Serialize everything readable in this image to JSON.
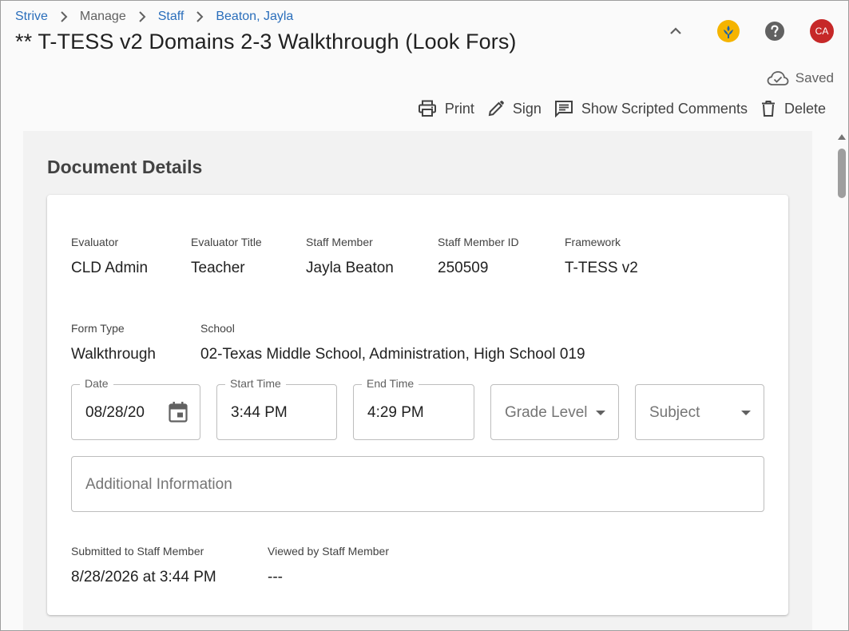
{
  "breadcrumb": {
    "items": [
      "Strive",
      "Manage",
      "Staff",
      "Beaton, Jayla"
    ]
  },
  "page_title": "** T-TESS v2 Domains 2-3 Walkthrough (Look Fors)",
  "header": {
    "avatar_initials": "CA",
    "avatar_color": "#c62828"
  },
  "status": {
    "saved_label": "Saved"
  },
  "toolbar": {
    "print_label": "Print",
    "sign_label": "Sign",
    "comments_label": "Show Scripted Comments",
    "delete_label": "Delete"
  },
  "document_details": {
    "title": "Document Details",
    "evaluator": {
      "label": "Evaluator",
      "value": "CLD Admin"
    },
    "evaluator_title": {
      "label": "Evaluator Title",
      "value": "Teacher"
    },
    "staff_member": {
      "label": "Staff Member",
      "value": "Jayla Beaton"
    },
    "staff_member_id": {
      "label": "Staff Member ID",
      "value": "250509"
    },
    "framework": {
      "label": "Framework",
      "value": "T-TESS v2"
    },
    "form_type": {
      "label": "Form Type",
      "value": "Walkthrough"
    },
    "school": {
      "label": "School",
      "value": "02-Texas Middle School, Administration, High School 019"
    },
    "date": {
      "label": "Date",
      "value": "08/28/20"
    },
    "start_time": {
      "label": "Start Time",
      "value": "3:44 PM"
    },
    "end_time": {
      "label": "End Time",
      "value": "4:29 PM"
    },
    "grade_level": {
      "placeholder": "Grade Level"
    },
    "subject": {
      "placeholder": "Subject"
    },
    "additional_info": {
      "placeholder": "Additional Information"
    },
    "submitted": {
      "label": "Submitted to Staff Member",
      "value": "8/28/2026 at 3:44 PM"
    },
    "viewed": {
      "label": "Viewed by Staff Member",
      "value": "---"
    }
  },
  "colors": {
    "link": "#2a6ebb",
    "accent_logo": "#f5b400"
  }
}
